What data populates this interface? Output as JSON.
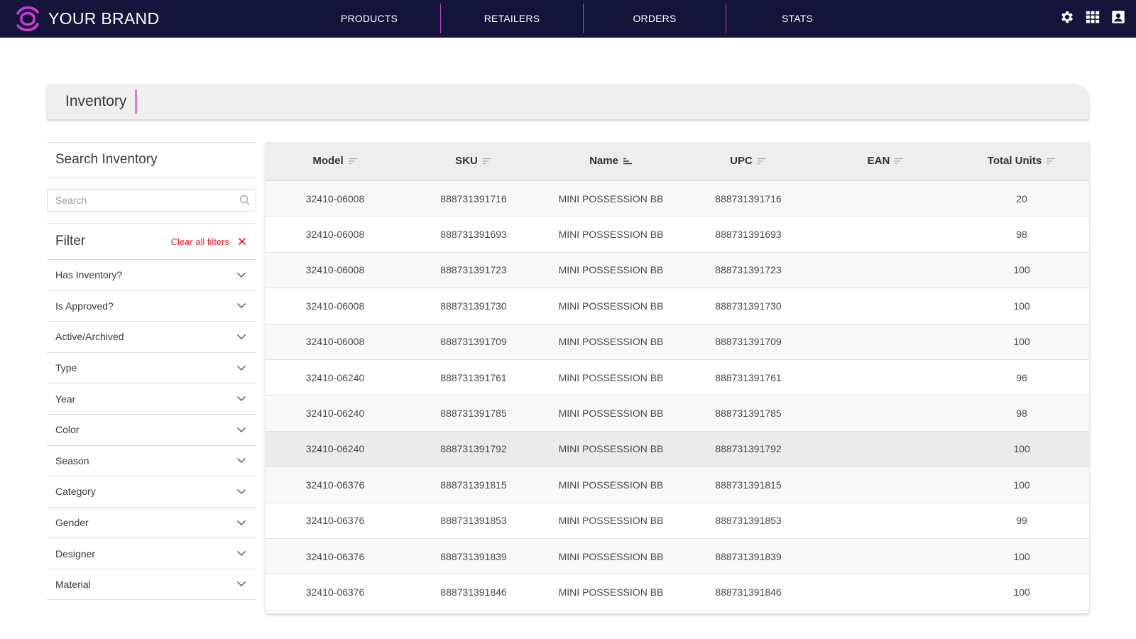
{
  "brand": {
    "name": "YOUR BRAND",
    "logo_icon": "brand-logo-icon"
  },
  "nav": {
    "items": [
      {
        "label": "PRODUCTS"
      },
      {
        "label": "RETAILERS"
      },
      {
        "label": "ORDERS"
      },
      {
        "label": "STATS"
      }
    ],
    "icons": [
      "gear-icon",
      "apps-grid-icon",
      "account-icon"
    ]
  },
  "page": {
    "title": "Inventory"
  },
  "sidebar": {
    "search_heading": "Search Inventory",
    "search_placeholder": "Search",
    "search_value": "",
    "filter_heading": "Filter",
    "clear_label": "Clear all filters",
    "filters": [
      {
        "label": "Has Inventory?"
      },
      {
        "label": "Is Approved?"
      },
      {
        "label": "Active/Archived"
      },
      {
        "label": "Type"
      },
      {
        "label": "Year"
      },
      {
        "label": "Color"
      },
      {
        "label": "Season"
      },
      {
        "label": "Category"
      },
      {
        "label": "Gender"
      },
      {
        "label": "Designer"
      },
      {
        "label": "Material"
      }
    ]
  },
  "table": {
    "columns": [
      {
        "label": "Model",
        "sort": "none"
      },
      {
        "label": "SKU",
        "sort": "none"
      },
      {
        "label": "Name",
        "sort": "active"
      },
      {
        "label": "UPC",
        "sort": "none"
      },
      {
        "label": "EAN",
        "sort": "none"
      },
      {
        "label": "Total Units",
        "sort": "none"
      }
    ],
    "hover_row": 7,
    "rows": [
      [
        "32410-06008",
        "888731391716",
        "MINI POSSESSION BB",
        "888731391716",
        "",
        "20"
      ],
      [
        "32410-06008",
        "888731391693",
        "MINI POSSESSION BB",
        "888731391693",
        "",
        "98"
      ],
      [
        "32410-06008",
        "888731391723",
        "MINI POSSESSION BB",
        "888731391723",
        "",
        "100"
      ],
      [
        "32410-06008",
        "888731391730",
        "MINI POSSESSION BB",
        "888731391730",
        "",
        "100"
      ],
      [
        "32410-06008",
        "888731391709",
        "MINI POSSESSION BB",
        "888731391709",
        "",
        "100"
      ],
      [
        "32410-06240",
        "888731391761",
        "MINI POSSESSION BB",
        "888731391761",
        "",
        "96"
      ],
      [
        "32410-06240",
        "888731391785",
        "MINI POSSESSION BB",
        "888731391785",
        "",
        "98"
      ],
      [
        "32410-06240",
        "888731391792",
        "MINI POSSESSION BB",
        "888731391792",
        "",
        "100"
      ],
      [
        "32410-06376",
        "888731391815",
        "MINI POSSESSION BB",
        "888731391815",
        "",
        "100"
      ],
      [
        "32410-06376",
        "888731391853",
        "MINI POSSESSION BB",
        "888731391853",
        "",
        "99"
      ],
      [
        "32410-06376",
        "888731391839",
        "MINI POSSESSION BB",
        "888731391839",
        "",
        "100"
      ],
      [
        "32410-06376",
        "888731391846",
        "MINI POSSESSION BB",
        "888731391846",
        "",
        "100"
      ]
    ]
  },
  "colors": {
    "topbar": "#14133a",
    "accent_magenta": "#c23ac9",
    "title_accent": "#ef6fe0",
    "clear_red": "#e0242b"
  }
}
